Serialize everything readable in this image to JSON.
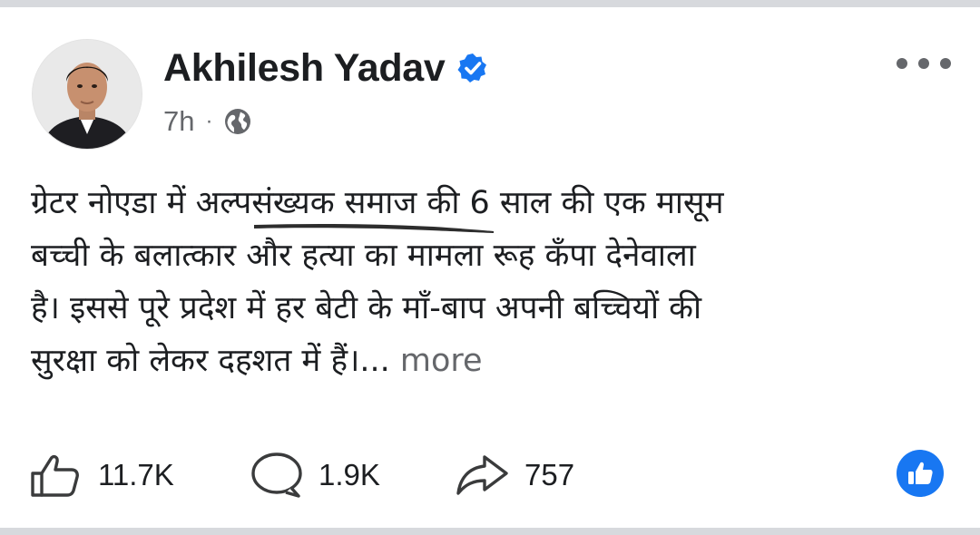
{
  "post": {
    "author": "Akhilesh Yadav",
    "verified": true,
    "time": "7h",
    "separator": "·",
    "audience_icon": "globe-icon",
    "text_lines": [
      "ग्रेटर नोएडा में अल्पसंख्यक समाज की 6 साल की एक मासूम",
      "बच्ची के बलात्कार और हत्या का मामला रूह कँपा देनेवाला",
      "है। इससे पूरे प्रदेश में हर बेटी के माँ-बाप अपनी बच्चियों की",
      "सुरक्षा को लेकर दहशत में हैं।..."
    ],
    "see_more": "more"
  },
  "stats": {
    "likes": "11.7K",
    "comments": "1.9K",
    "shares": "757"
  },
  "icons": {
    "menu": "more-options-icon",
    "like": "thumbs-up-icon",
    "comment": "comment-bubble-icon",
    "share": "share-arrow-icon",
    "reaction": "like-reaction-icon"
  },
  "colors": {
    "brand_blue": "#1877f2",
    "secondary_text": "#65676b",
    "primary_text": "#1c1e21"
  }
}
